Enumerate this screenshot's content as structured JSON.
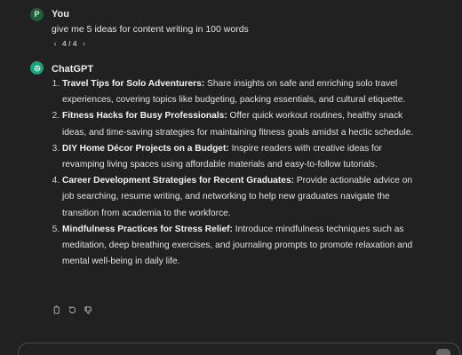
{
  "user_message": {
    "avatar_letter": "P",
    "author": "You",
    "text": "give me 5 ideas for content writing in 100 words",
    "pager": {
      "current": "4",
      "total": "4",
      "label": "4 / 4",
      "prev_icon": "chevron-left-icon",
      "next_icon": "chevron-right-icon"
    }
  },
  "assistant_message": {
    "author": "ChatGPT",
    "avatar_icon": "openai-logo-icon",
    "ideas": [
      {
        "title": "Travel Tips for Solo Adventurers:",
        "body": " Share insights on safe and enriching solo travel experiences, covering topics like budgeting, packing essentials, and cultural etiquette."
      },
      {
        "title": "Fitness Hacks for Busy Professionals:",
        "body": " Offer quick workout routines, healthy snack ideas, and time-saving strategies for maintaining fitness goals amidst a hectic schedule."
      },
      {
        "title": "DIY Home Décor Projects on a Budget:",
        "body": " Inspire readers with creative ideas for revamping living spaces using affordable materials and easy-to-follow tutorials."
      },
      {
        "title": "Career Development Strategies for Recent Graduates:",
        "body": " Provide actionable advice on job searching, resume writing, and networking to help new graduates navigate the transition from academia to the workforce."
      },
      {
        "title": "Mindfulness Practices for Stress Relief:",
        "body": " Introduce mindfulness techniques such as meditation, deep breathing exercises, and journaling prompts to promote relaxation and mental well-being in daily life."
      }
    ],
    "actions": [
      "copy-icon",
      "regenerate-icon",
      "thumbs-down-icon"
    ]
  },
  "colors": {
    "background": "#212121",
    "text": "#ececec",
    "user_avatar": "#1f5c3a",
    "assistant_avatar": "#19a27c"
  }
}
